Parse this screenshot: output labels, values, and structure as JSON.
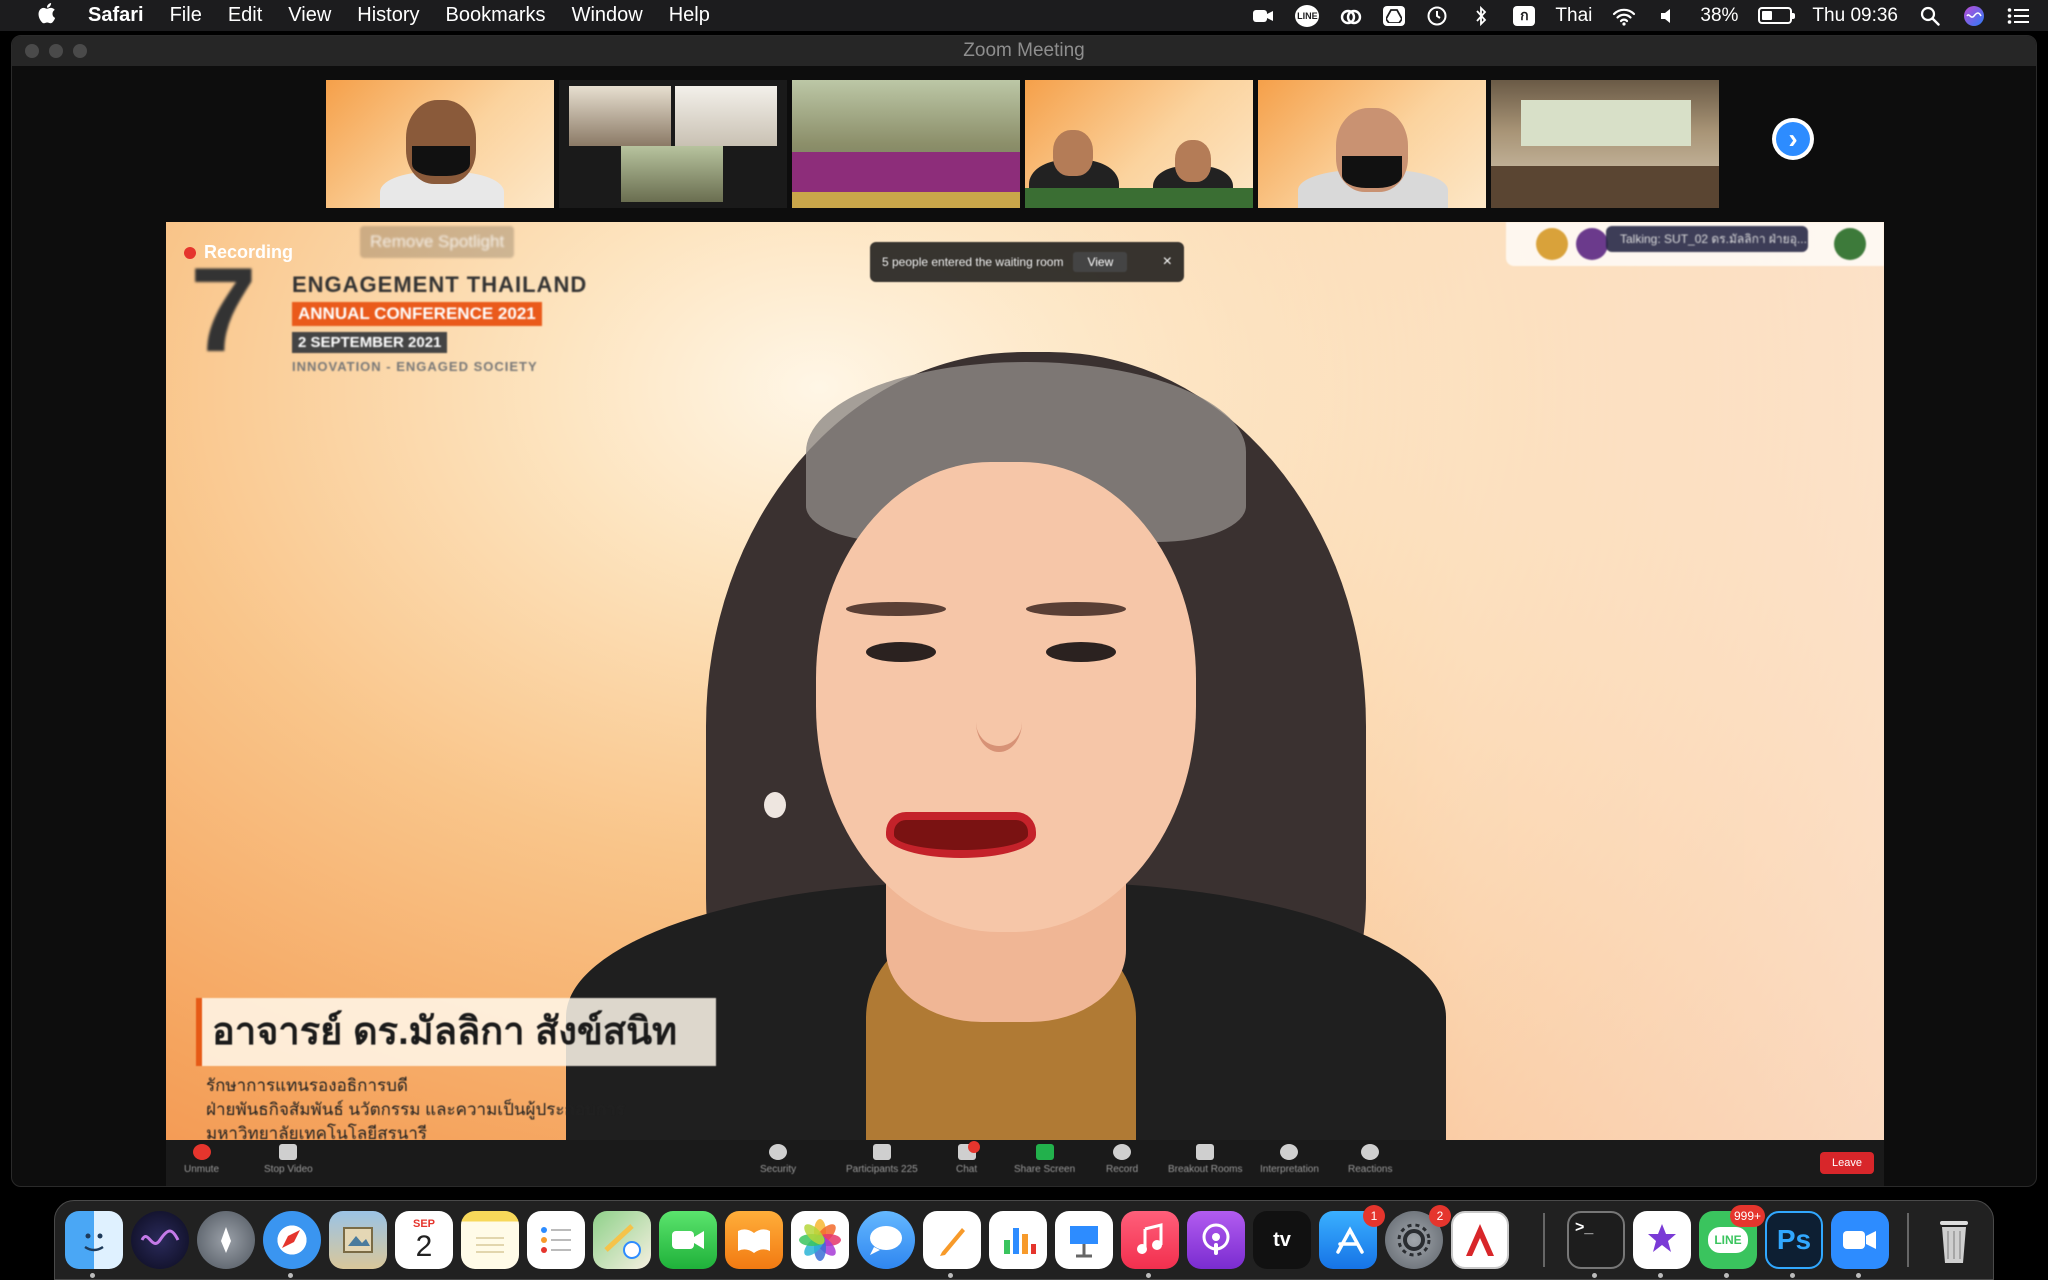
{
  "menubar": {
    "app_name": "Safari",
    "menus": [
      "File",
      "Edit",
      "View",
      "History",
      "Bookmarks",
      "Window",
      "Help"
    ],
    "input_source": "Thai",
    "battery": "38%",
    "battery_level": 0.38,
    "clock": "Thu 09:36"
  },
  "window": {
    "title": "Zoom Meeting"
  },
  "meeting": {
    "recording_label": "Recording",
    "remove_spotlight": "Remove Spotlight",
    "waiting_room_text": "5 people entered the waiting room",
    "waiting_view_label": "View",
    "talking_text": "Talking: SUT_02 ดร.มัลลิกา ฝ่ายอุ...",
    "conference": {
      "number": "7",
      "line1": "ENGAGEMENT THAILAND",
      "line2": "ANNUAL CONFERENCE 2021",
      "line3": "2 SEPTEMBER 2021",
      "line4": "INNOVATION - ENGAGED SOCIETY"
    },
    "speaker_name": "อาจารย์ ดร.มัลลิกา สังข์สนิท",
    "speaker_title_1": "รักษาการแทนรองอธิการบดี",
    "speaker_title_2": "ฝ่ายพันธกิจสัมพันธ์ นวัตกรรม และความเป็นผู้ประกอบการ",
    "speaker_title_3": "มหาวิทยาลัยเทคโนโลยีสุรนารี"
  },
  "toolbar": {
    "unmute": "Unmute",
    "stop_video": "Stop Video",
    "security": "Security",
    "participants": "Participants",
    "participants_count": "225",
    "chat": "Chat",
    "share_screen": "Share Screen",
    "record": "Record",
    "breakout_rooms": "Breakout Rooms",
    "interpretation": "Interpretation",
    "reactions": "Reactions",
    "leave": "Leave"
  },
  "dock": {
    "calendar_month": "SEP",
    "calendar_day": "2",
    "appstore_badge": "1",
    "settings_badge": "2",
    "line_badge": "999+",
    "line_label": "LINE",
    "ps_label": "Ps",
    "terminal_label": ">_",
    "appletv_label": "tv"
  }
}
